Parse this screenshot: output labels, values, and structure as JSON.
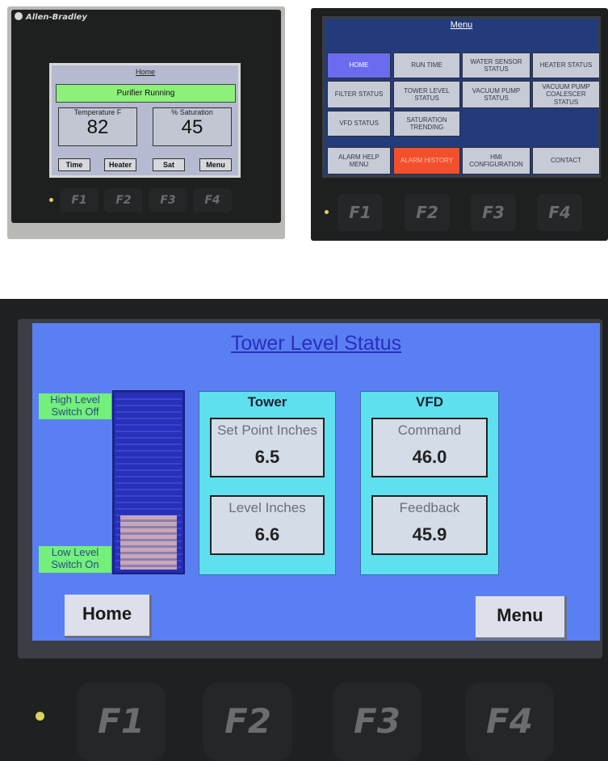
{
  "panel1": {
    "brand": "Allen-Bradley",
    "title": "Home",
    "banner": "Purifier Running",
    "temperature": {
      "label": "Temperature F",
      "value": "82"
    },
    "saturation": {
      "label": "% Saturation",
      "value": "45"
    },
    "buttons": [
      "Time",
      "Heater",
      "Sat",
      "Menu"
    ],
    "fkeys": [
      "F1",
      "F2",
      "F3",
      "F4"
    ]
  },
  "panel2": {
    "title": "Menu",
    "buttons": [
      "HOME",
      "RUN TIME",
      "WATER SENSOR STATUS",
      "HEATER STATUS",
      "FILTER STATUS",
      "TOWER LEVEL STATUS",
      "VACUUM PUMP STATUS",
      "VACUUM PUMP COALESCER STATUS",
      "VFD STATUS",
      "SATURATION TRENDING",
      "ALARM HELP MENU",
      "ALARM HISTORY",
      "HMI CONFIGURATION",
      "CONTACT"
    ],
    "fkeys": [
      "F1",
      "F2",
      "F3",
      "F4"
    ]
  },
  "panel3": {
    "title": "Tower Level Status",
    "high_level": "High Level Switch Off",
    "low_level": "Low Level Switch On",
    "tank_fill_percent": 30,
    "tower": {
      "title": "Tower",
      "set_point": {
        "label": "Set Point Inches",
        "value": "6.5"
      },
      "level": {
        "label": "Level Inches",
        "value": "6.6"
      }
    },
    "vfd": {
      "title": "VFD",
      "command": {
        "label": "Command",
        "value": "46.0"
      },
      "feedback": {
        "label": "Feedback",
        "value": "45.9"
      }
    },
    "home_button": "Home",
    "menu_button": "Menu",
    "fkeys": [
      "F1",
      "F2",
      "F3",
      "F4"
    ]
  }
}
